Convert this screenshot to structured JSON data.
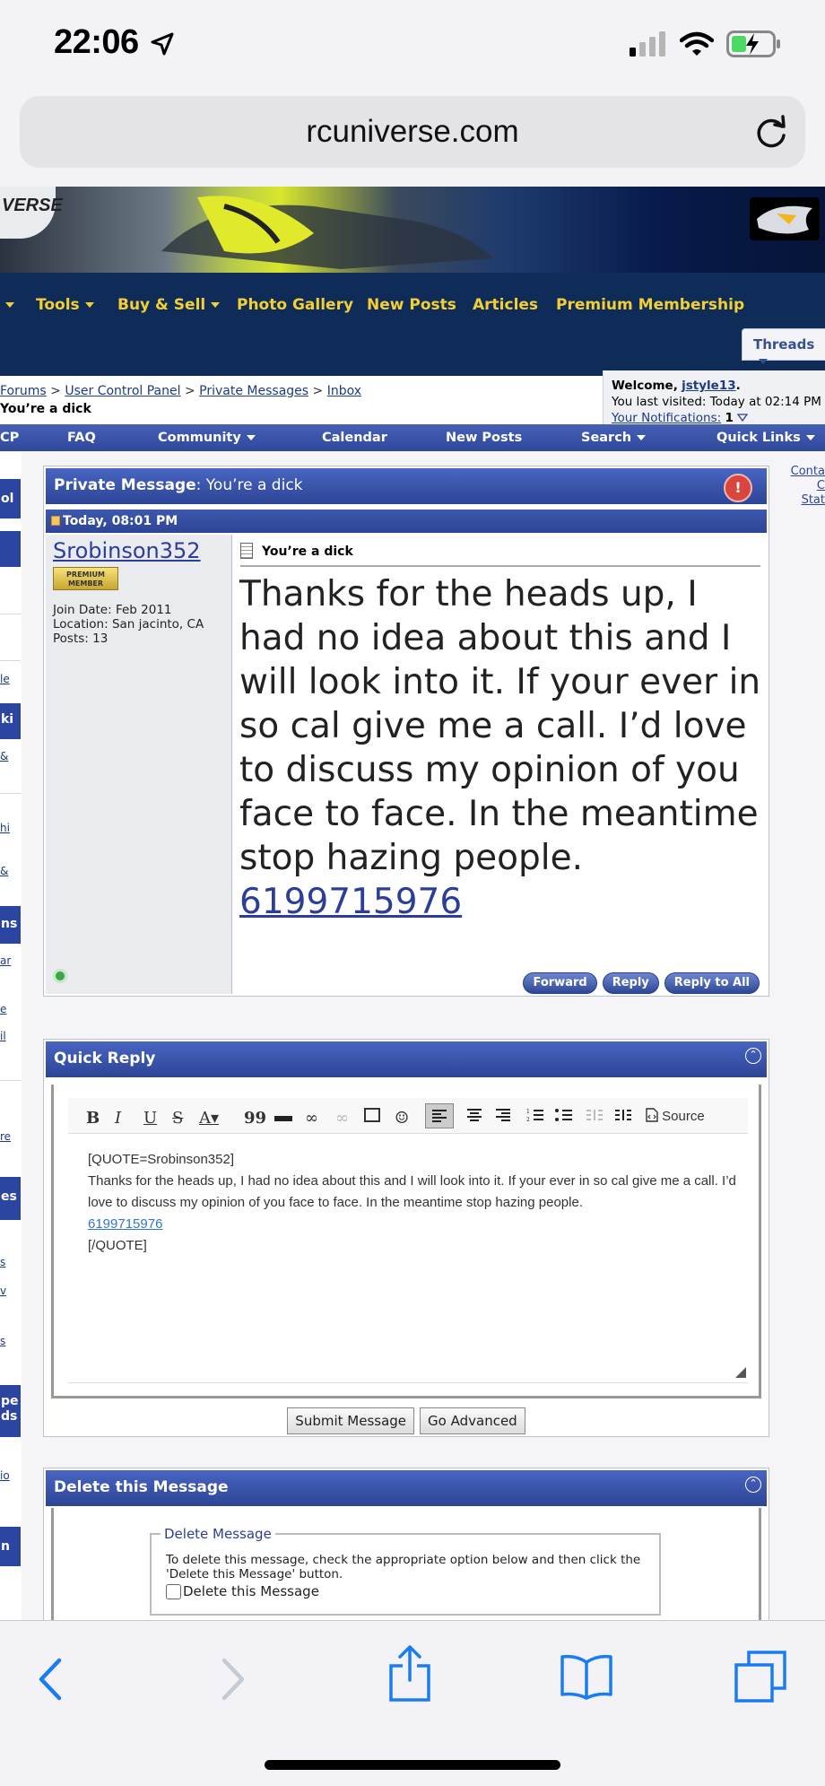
{
  "status": {
    "time": "22:06"
  },
  "browser": {
    "url": "rcuniverse.com"
  },
  "banner": {
    "logo_text": "VERSE"
  },
  "nav": {
    "items": [
      {
        "label": "Tools",
        "dropdown": true
      },
      {
        "label": "Buy & Sell",
        "dropdown": true
      },
      {
        "label": "Photo Gallery",
        "dropdown": false
      },
      {
        "label": "New Posts",
        "dropdown": false
      },
      {
        "label": "Articles",
        "dropdown": false
      },
      {
        "label": "Premium Membership",
        "dropdown": false
      }
    ],
    "threads_tab": "Threads"
  },
  "breadcrumb": {
    "items": [
      "Forums",
      "User Control Panel",
      "Private Messages",
      "Inbox"
    ],
    "separator": ">",
    "current": "You’re a dick"
  },
  "welcome": {
    "prefix": "Welcome,",
    "username": "jstyle13",
    "suffix": ".",
    "last_visited": "You last visited: Today at 02:14 PM",
    "notifications_label": "Your Notifications:",
    "notifications_count": "1"
  },
  "subnav": {
    "items": [
      "CP",
      "FAQ",
      "Community",
      "Calendar",
      "New Posts",
      "Search",
      "Quick Links"
    ]
  },
  "left_strip": {
    "items": [
      "ol",
      "le",
      "ki",
      "&",
      "hi",
      "&",
      "ns",
      "ar",
      "e",
      "il",
      "re",
      "es",
      "s",
      "v",
      "s",
      "pe",
      "ds",
      "io",
      "n"
    ]
  },
  "right_strip": {
    "lines": [
      "Conta",
      "C",
      "Stat"
    ]
  },
  "pm": {
    "header_label": "Private Message",
    "header_title": "You’re a dick",
    "date": "Today, 08:01 PM",
    "username": "Srobinson352",
    "badge": "PREMIUM MEMBER",
    "join_date": "Join Date: Feb 2011",
    "location": "Location: San jacinto, CA",
    "posts": "Posts: 13",
    "subject": "You’re a dick",
    "body": "Thanks for the heads up, I had no idea about this and I will look into it. If your ever in so cal give me a call. I’d love to discuss my opinion of you face to face. In the meantime stop hazing people.",
    "phone": "6199715976",
    "buttons": {
      "forward": "Forward",
      "reply": "Reply",
      "reply_all": "Reply to All"
    }
  },
  "quick_reply": {
    "title": "Quick Reply",
    "toolbar": {
      "source": "Source"
    },
    "editor_lines": [
      "[QUOTE=Srobinson352]",
      "Thanks for the heads up, I had no idea about this and I will look into it. If your ever in so cal give me a call. I’d love to discuss my opinion of you face to face. In the meantime stop hazing people.",
      "6199715976",
      "[/QUOTE]"
    ],
    "submit": "Submit Message",
    "advanced": "Go Advanced"
  },
  "delete_panel": {
    "title": "Delete this Message",
    "legend": "Delete Message",
    "instructions": "To delete this message, check the appropriate option below and then click the 'Delete this Message' button.",
    "checkbox_label": "Delete this Message"
  }
}
